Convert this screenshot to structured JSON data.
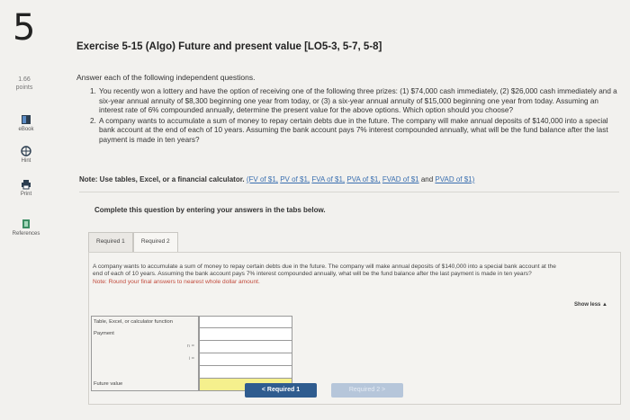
{
  "question_number": "5",
  "points": "1.66",
  "points_label": "points",
  "sidebar": [
    {
      "label": "eBook",
      "icon": "book-icon"
    },
    {
      "label": "Hint",
      "icon": "globe-icon"
    },
    {
      "label": "Print",
      "icon": "printer-icon"
    },
    {
      "label": "References",
      "icon": "references-icon"
    }
  ],
  "title": "Exercise 5-15 (Algo) Future and present value [LO5-3, 5-7, 5-8]",
  "instructions": "Answer each of the following independent questions.",
  "questions": [
    {
      "num": "1.",
      "text": "You recently won a lottery and have the option of receiving one of the following three prizes: (1) $74,000 cash immediately, (2) $26,000 cash immediately and a six-year annual annuity of $8,300 beginning one year from today, or (3) a six-year annual annuity of $15,000 beginning one year from today. Assuming an interest rate of 6% compounded annually, determine the present value for the above options. Which option should you choose?"
    },
    {
      "num": "2.",
      "text": "A company wants to accumulate a sum of money to repay certain debts due in the future. The company will make annual deposits of $140,000 into a special bank account at the end of each of 10 years. Assuming the bank account pays 7% interest compounded annually, what will be the fund balance after the last payment is made in ten years?"
    }
  ],
  "note": {
    "prefix": "Note: Use tables, Excel, or a financial calculator.",
    "links": [
      "(FV of $1,",
      "PV of $1,",
      "FVA of $1,",
      "PVA of $1,",
      "FVAD of $1",
      "and",
      "PVAD of $1)"
    ]
  },
  "complete_text": "Complete this question by entering your answers in the tabs below.",
  "tabs": [
    {
      "label": "Required 1"
    },
    {
      "label": "Required 2"
    }
  ],
  "panel": {
    "text": "A company wants to accumulate a sum of money to repay certain debts due in the future. The company will make annual deposits of $140,000 into a special bank account at the end of each of 10 years. Assuming the bank account pays 7% interest compounded annually, what will be the fund balance after the last payment is made in ten years?",
    "note": "Note: Round your final answers to nearest whole dollar amount.",
    "show_less": "Show less ▲"
  },
  "table": {
    "rows": [
      {
        "label": "Table, Excel, or calculator function",
        "value": ""
      },
      {
        "label": "Payment",
        "value": ""
      },
      {
        "label": "n =",
        "value": ""
      },
      {
        "label": "i =",
        "value": ""
      },
      {
        "label": "",
        "value": ""
      },
      {
        "label": "Future value",
        "value": ""
      }
    ]
  },
  "nav": {
    "prev": "< Required 1",
    "next": "Required 2 >"
  }
}
